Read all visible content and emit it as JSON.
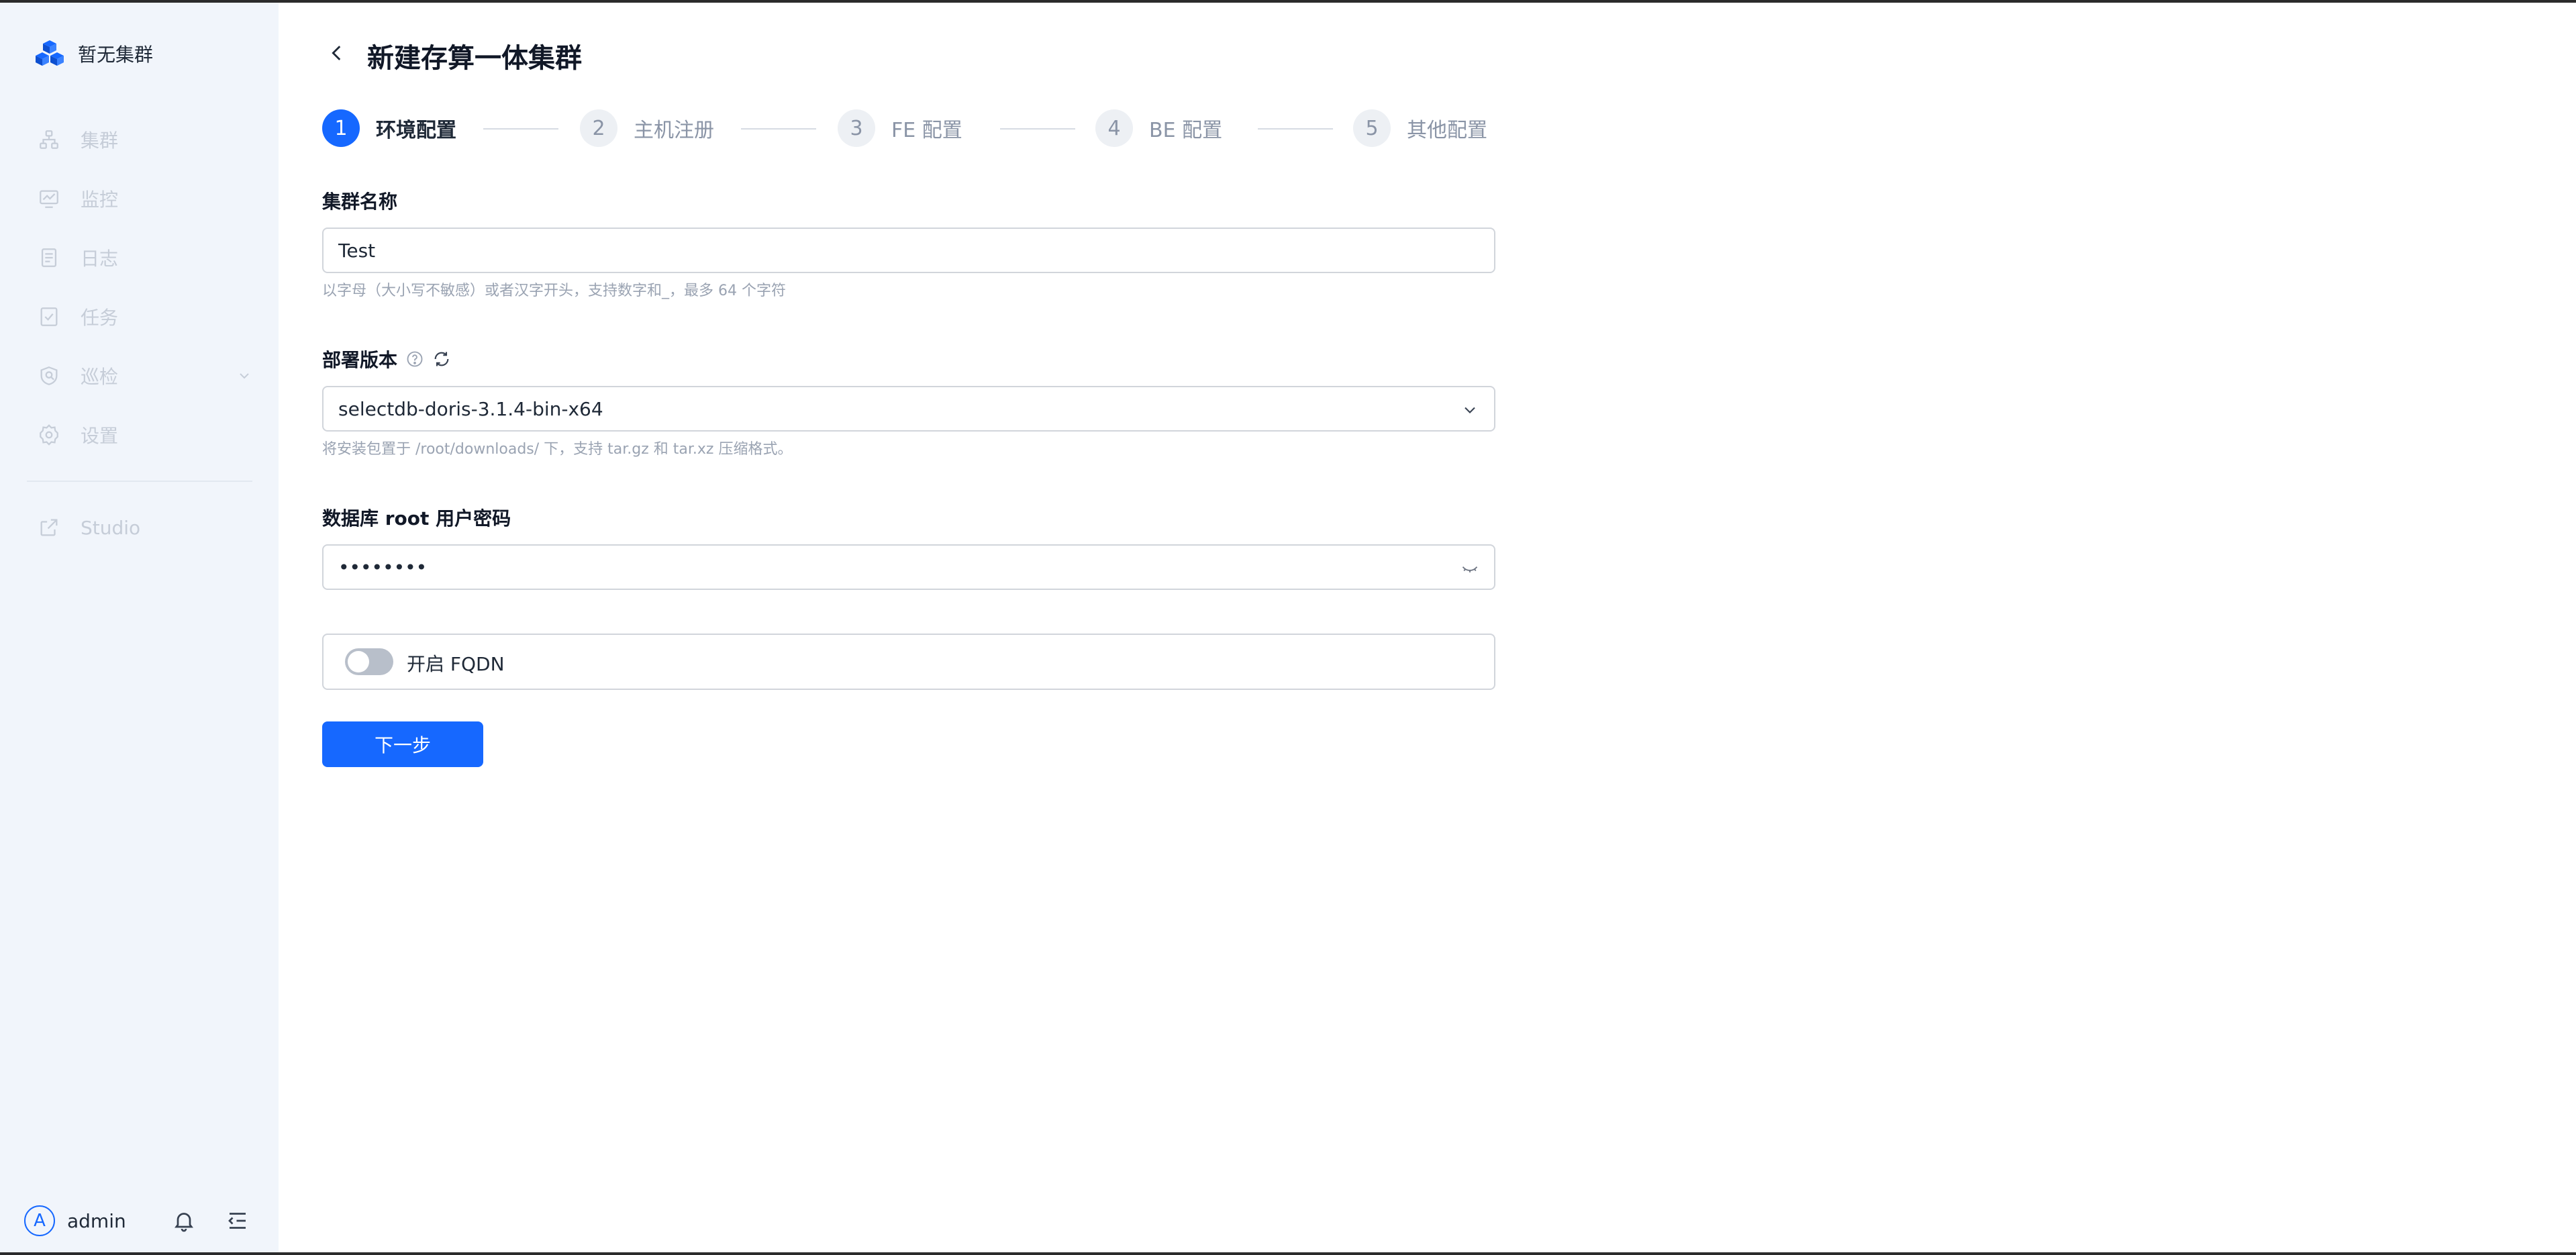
{
  "sidebar": {
    "brand": "暂无集群",
    "items": [
      {
        "label": "集群",
        "icon": "cluster-icon"
      },
      {
        "label": "监控",
        "icon": "monitor-icon"
      },
      {
        "label": "日志",
        "icon": "log-icon"
      },
      {
        "label": "任务",
        "icon": "task-icon"
      },
      {
        "label": "巡检",
        "icon": "inspection-icon"
      },
      {
        "label": "设置",
        "icon": "gear-icon"
      },
      {
        "label": "Studio",
        "icon": "external-link-icon"
      }
    ],
    "user": {
      "avatar": "A",
      "name": "admin"
    }
  },
  "header": {
    "title": "新建存算一体集群"
  },
  "steps": [
    {
      "num": "1",
      "label": "环境配置",
      "active": true
    },
    {
      "num": "2",
      "label": "主机注册",
      "active": false
    },
    {
      "num": "3",
      "label": "FE 配置",
      "active": false
    },
    {
      "num": "4",
      "label": "BE 配置",
      "active": false
    },
    {
      "num": "5",
      "label": "其他配置",
      "active": false
    }
  ],
  "form": {
    "cluster_name": {
      "label": "集群名称",
      "value": "Test",
      "hint": "以字母（大小写不敏感）或者汉字开头，支持数字和_，最多 64 个字符"
    },
    "version": {
      "label": "部署版本",
      "value": "selectdb-doris-3.1.4-bin-x64",
      "hint": "将安装包置于 /root/downloads/ 下，支持 tar.gz 和 tar.xz 压缩格式。"
    },
    "password": {
      "label": "数据库 root 用户密码",
      "value": "••••••••"
    },
    "fqdn": {
      "label": "开启 FQDN",
      "enabled": false
    },
    "next_button": "下一步"
  },
  "colors": {
    "accent": "#1668ff",
    "sidebar_bg": "#f1f5fb"
  }
}
